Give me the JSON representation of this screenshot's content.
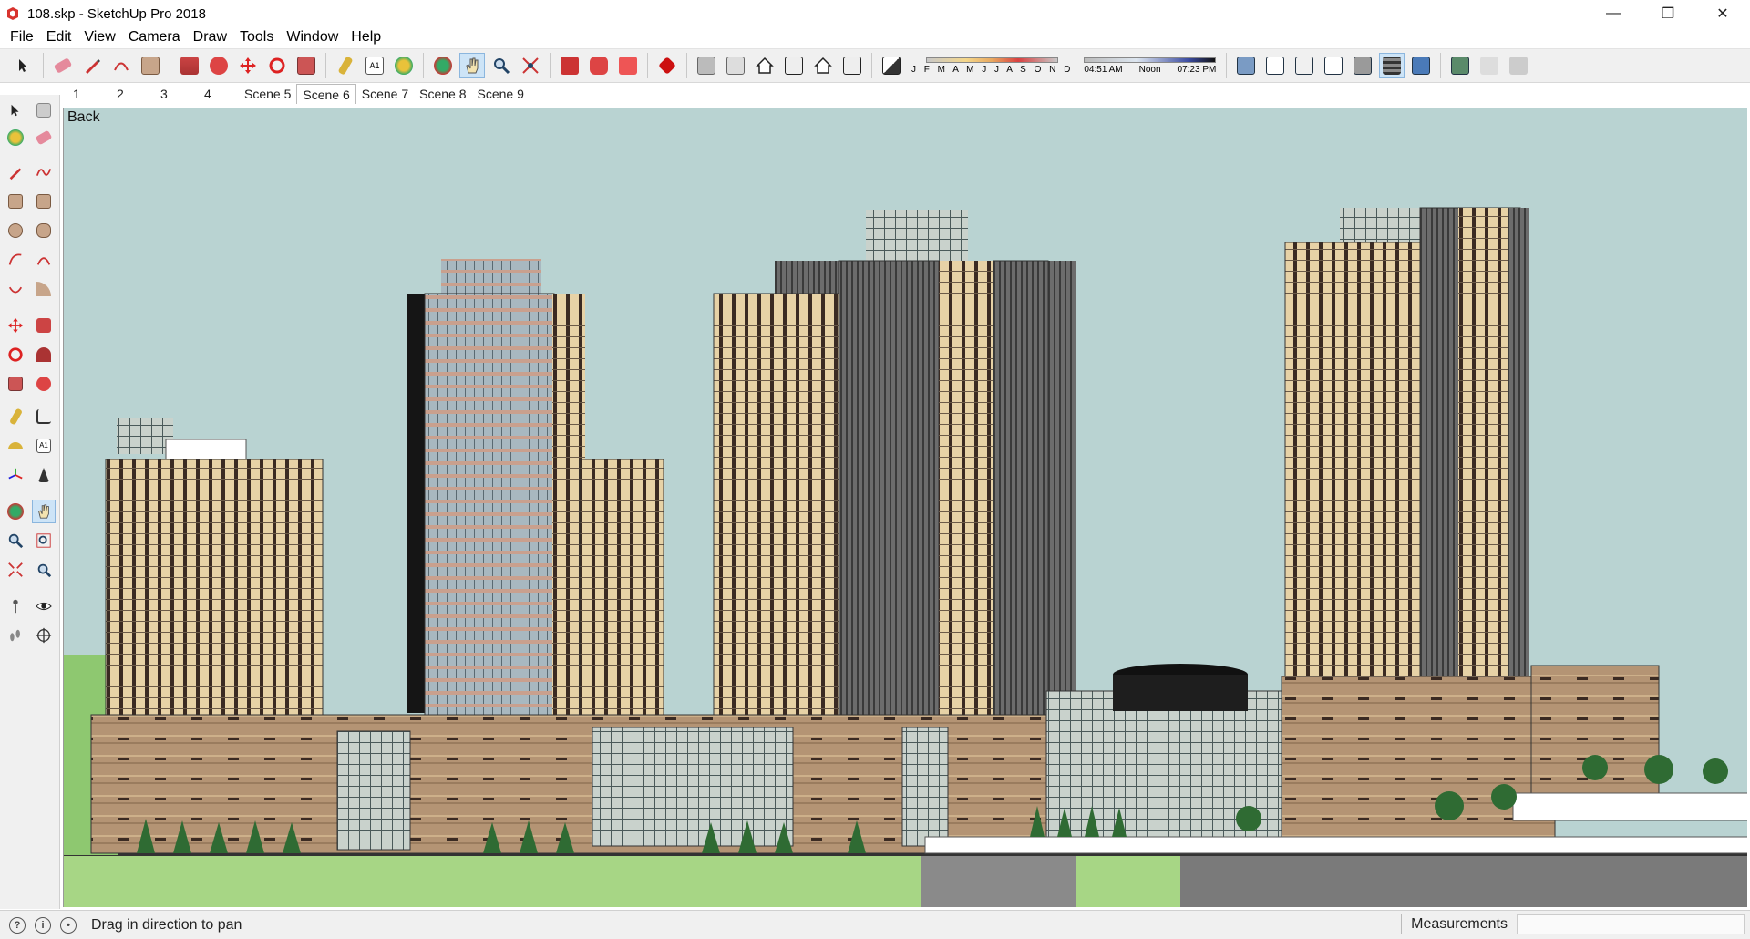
{
  "window": {
    "title": "108.skp - SketchUp Pro 2018",
    "minimize_glyph": "—",
    "restore_glyph": "❐",
    "close_glyph": "✕"
  },
  "menu": [
    "File",
    "Edit",
    "View",
    "Camera",
    "Draw",
    "Tools",
    "Window",
    "Help"
  ],
  "toolbar": {
    "shadow_months_label": "J F M A M J J A S O N D",
    "time_start": "04:51 AM",
    "time_noon": "Noon",
    "time_end": "07:23 PM"
  },
  "scenes": {
    "tabs": [
      "1",
      "2",
      "3",
      "4",
      "Scene 5",
      "Scene 6",
      "Scene 7",
      "Scene 8",
      "Scene 9"
    ],
    "active": "Scene 6"
  },
  "viewport": {
    "view_name": "Back",
    "sky_color": "#b9d3d2"
  },
  "status": {
    "hint": "Drag in direction to pan",
    "measurements_label": "Measurements",
    "measurements_value": ""
  },
  "colors": {
    "accent": "#cde4f7",
    "facade_tan": "#e7d2a6",
    "facade_brown": "#b49474",
    "glass": "#a8b8c0",
    "dark": "#1a1a1a",
    "lawn": "#a7d685",
    "road": "#8a8a8a"
  }
}
